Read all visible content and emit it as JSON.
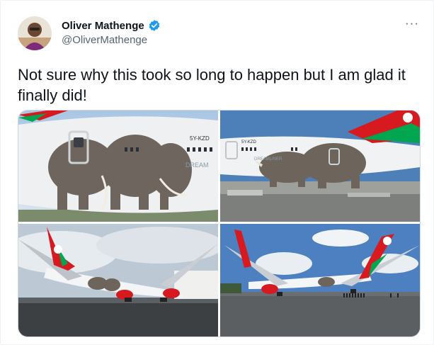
{
  "tweet": {
    "author": {
      "display_name": "Oliver Mathenge",
      "handle": "@OliverMathenge",
      "verified": true,
      "avatar_icon": "user-avatar-photo"
    },
    "text": "Not sure why this took so long to happen but I am glad it finally did!",
    "more_label": "···",
    "media": [
      {
        "name": "photo-elephant-livery",
        "tail_registration": "5Y-KZD",
        "fuselage_text": "DREAM"
      },
      {
        "name": "photo-rhino-livery",
        "tail_registration": "5Y-KZD",
        "fuselage_text": "DREAMLINER"
      },
      {
        "name": "photo-parked-plane-left"
      },
      {
        "name": "photo-parked-plane-right"
      }
    ]
  },
  "colors": {
    "verified_blue": "#1d9bf0",
    "kq_red": "#d71920",
    "kq_green": "#00a650",
    "text_primary": "#0f1419",
    "text_secondary": "#536471"
  }
}
